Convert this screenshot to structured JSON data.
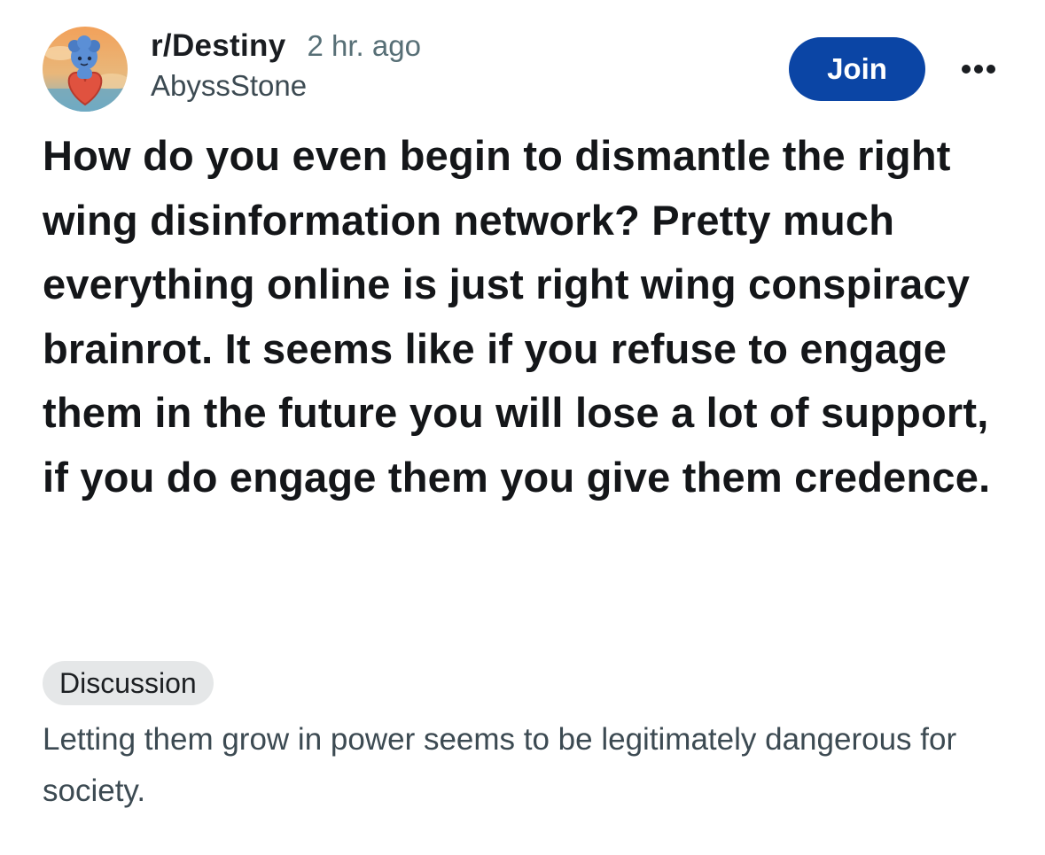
{
  "header": {
    "subreddit": "r/Destiny",
    "time": "2 hr. ago",
    "author": "AbyssStone",
    "join_label": "Join",
    "more_icon": "ellipsis-icon",
    "avatar_icon": "community-avatar-icon"
  },
  "post": {
    "title": "How do you even begin to dismantle the right wing disinformation network? Pretty much everything online is just right wing conspiracy brainrot. It seems like if you refuse to engage them in the future you will lose a lot of support, if you do engage them you give them credence.",
    "flair": "Discussion",
    "body": "Letting them grow in power seems to be legitimately dangerous for society."
  },
  "colors": {
    "join_button": "#0b45a5",
    "flair_background": "#e5e7e8",
    "muted_text": "#576f76"
  }
}
